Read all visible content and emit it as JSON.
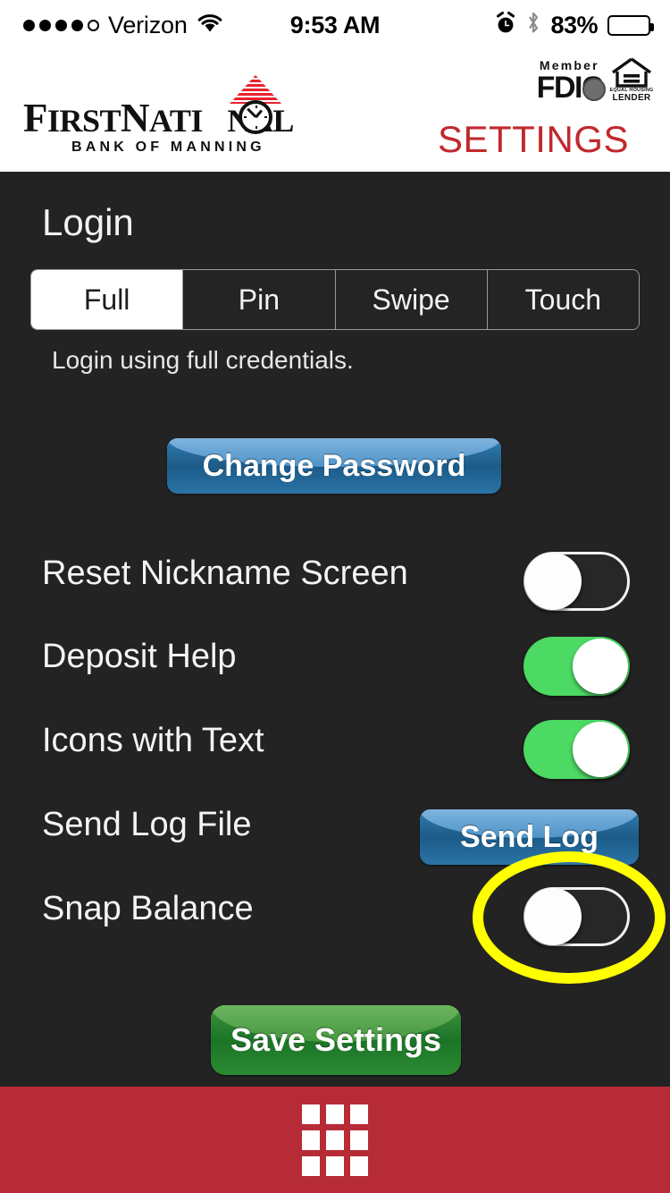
{
  "status_bar": {
    "signal_dots_filled": 4,
    "signal_dots_total": 5,
    "carrier": "Verizon",
    "wifi_icon": "wifi-icon",
    "time": "9:53 AM",
    "alarm_icon": "alarm-clock-icon",
    "bluetooth_icon": "bluetooth-icon",
    "battery_percent": "83%",
    "battery_level": 83
  },
  "header": {
    "logo": {
      "line1_part1": "F",
      "line1_part2": "IRST",
      "line1_part3": "N",
      "line1_part4": "ATI",
      "line1_part5": "NAL",
      "subtitle": "BANK OF MANNING",
      "clock_icon": "clock-icon",
      "roof_icon": "striped-pediment-icon"
    },
    "fdic": {
      "member_label": "Member",
      "fdic_label": "FDIC",
      "seal_icon": "fdic-seal-icon"
    },
    "equal_housing": {
      "house_icon": "equal-housing-house-icon",
      "line1": "EQUAL HOUSING",
      "line2": "LENDER"
    },
    "settings_link": "SETTINGS"
  },
  "main": {
    "section_title": "Login",
    "segmented_control": {
      "options": [
        {
          "label": "Full",
          "selected": true
        },
        {
          "label": "Pin",
          "selected": false
        },
        {
          "label": "Swipe",
          "selected": false
        },
        {
          "label": "Touch",
          "selected": false
        }
      ]
    },
    "help_text": "Login using full credentials.",
    "change_password_button": "Change Password",
    "rows": [
      {
        "label": "Reset Nickname Screen",
        "control": "toggle",
        "state": "off"
      },
      {
        "label": "Deposit Help",
        "control": "toggle",
        "state": "on"
      },
      {
        "label": "Icons with Text",
        "control": "toggle",
        "state": "on"
      },
      {
        "label": "Send Log File",
        "control": "button",
        "button_label": "Send Log"
      },
      {
        "label": "Snap Balance",
        "control": "toggle",
        "state": "off",
        "highlighted": true
      }
    ],
    "save_button": "Save Settings"
  },
  "annotation": {
    "type": "ellipse-highlight",
    "color": "#ffff00",
    "target": "snap-balance-toggle"
  },
  "bottom_bar": {
    "grid_icon": "grid-menu-icon",
    "color": "#b62b35"
  },
  "colors": {
    "background": "#232323",
    "header_background": "#ffffff",
    "accent_red": "#c1292e",
    "bottom_bar_red": "#b62b35",
    "toggle_on_green": "#4cd964",
    "button_blue": "#1f5c88",
    "button_green": "#1d7629",
    "highlight_yellow": "#ffff00"
  }
}
